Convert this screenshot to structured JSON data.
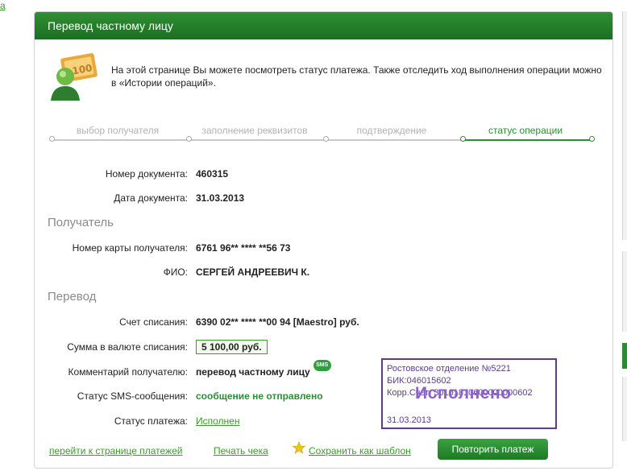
{
  "top_link": "а",
  "header": {
    "title": "Перевод частному лицу"
  },
  "info": {
    "text": "На этой странице Вы можете посмотреть статус платежа. Также отследить ход выполнения операции можно в «Истории операций»."
  },
  "steps": [
    {
      "label": "выбор получателя",
      "active": false
    },
    {
      "label": "заполнение реквизитов",
      "active": false
    },
    {
      "label": "подтверждение",
      "active": false
    },
    {
      "label": "статус операции",
      "active": true
    }
  ],
  "document": {
    "number_label": "Номер документа:",
    "number_value": "460315",
    "date_label": "Дата документа:",
    "date_value": "31.03.2013"
  },
  "recipient": {
    "section_title": "Получатель",
    "card_label": "Номер карты получателя:",
    "card_value": "6761 96** **** **56 73",
    "name_label": "ФИО:",
    "name_value": "СЕРГЕЙ АНДРЕЕВИЧ К."
  },
  "transfer": {
    "section_title": "Перевод",
    "account_label": "Счет списания:",
    "account_value": "6390 02** **** **00 94  [Maestro]  руб.",
    "amount_label": "Сумма в валюте списания:",
    "amount_value": "5 100,00  руб.",
    "comment_label": "Комментарий получателю:",
    "comment_value": "перевод частному лицу",
    "sms_badge": "SMS",
    "sms_status_label": "Статус SMS-сообщения:",
    "sms_status_value": "сообщение не отправлено",
    "payment_status_label": "Статус платежа:",
    "payment_status_value": "Исполнен"
  },
  "stamp": {
    "line1": "Ростовское отделение №5221",
    "line2": "БИК:046015602",
    "line3": "Корр.Счет: 30101810600000000602",
    "big": "Исполнено",
    "date": "31.03.2013"
  },
  "footer": {
    "payments_link": "перейти к странице платежей",
    "print_link": "Печать чека",
    "save_template": "Сохранить как шаблон",
    "repeat_button": "Повторить платеж"
  },
  "colors": {
    "accent": "#2e8b37",
    "header": "#1c6f22",
    "stamp": "#5b3d8c"
  }
}
